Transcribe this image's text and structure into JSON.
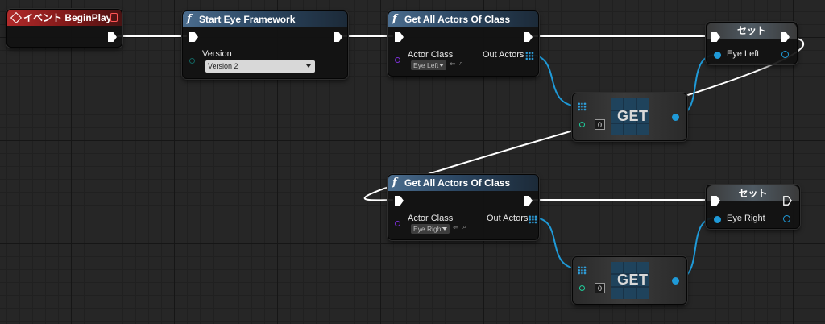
{
  "event_node": {
    "title": "イベント BeginPlay"
  },
  "start_eye_node": {
    "title": "Start Eye Framework",
    "version_label": "Version",
    "version_value": "Version 2"
  },
  "get_actors_left": {
    "title": "Get All Actors Of Class",
    "actor_class_label": "Actor Class",
    "class_value": "Eye Left",
    "out_actors_label": "Out Actors"
  },
  "get_actors_right": {
    "title": "Get All Actors Of Class",
    "actor_class_label": "Actor Class",
    "class_value": "Eye Right",
    "out_actors_label": "Out Actors"
  },
  "set_left": {
    "title": "セット",
    "var_label": "Eye Left"
  },
  "set_right": {
    "title": "セット",
    "var_label": "Eye Right"
  },
  "get_left": {
    "label": "GET",
    "index": "0"
  },
  "get_right": {
    "label": "GET",
    "index": "0"
  },
  "colors": {
    "exec_wire": "#ffffff",
    "object_wire": "#1f9ad8",
    "class_pin": "#7b2fd6",
    "int_pin": "#1fcf9d",
    "enum_pin": "#12635f"
  }
}
